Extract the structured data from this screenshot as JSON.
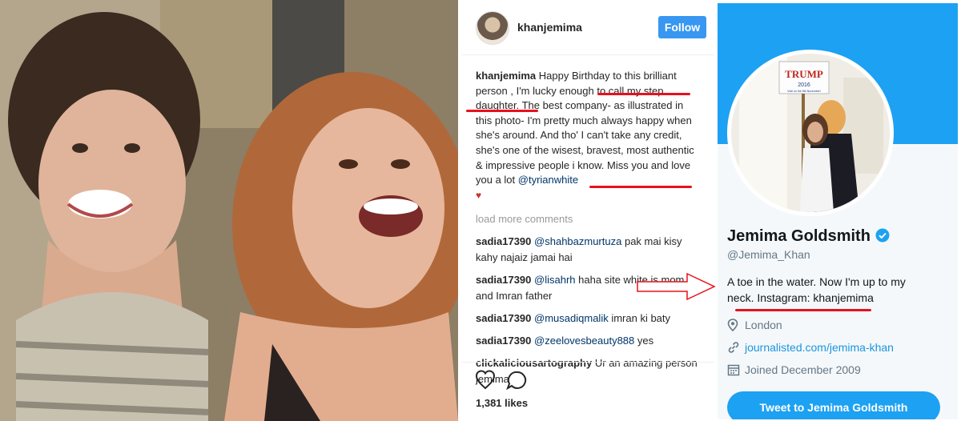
{
  "instagram": {
    "username": "khanjemima",
    "follow_label": "Follow",
    "caption_user": "khanjemima",
    "caption_text": "Happy Birthday to this brilliant person , I'm lucky enough to call my step daughter. The best company- as illustrated in this photo- I'm pretty much always happy when she's around. And tho' I can't take any credit, she's one of the wisest, bravest, most authentic & impressive people i know. Miss you and love you a lot",
    "caption_mention": "@tyrianwhite",
    "heart": "♥",
    "load_more": "load more comments",
    "comments": [
      {
        "user": "sadia17390",
        "mention": "@shahbazmurtuza",
        "text": "pak mai kisy kahy najaiz jamai hai"
      },
      {
        "user": "sadia17390",
        "mention": "@lisahrh",
        "text": "haha site white is mom and Imran father"
      },
      {
        "user": "sadia17390",
        "mention": "@musadiqmalik",
        "text": "imran ki baty"
      },
      {
        "user": "sadia17390",
        "mention": "@zeelovesbeauty888",
        "text": "yes"
      },
      {
        "user": "clickaliciousartography",
        "mention": "",
        "text": "Ur an amazing person jemima"
      }
    ],
    "likes": "1,381 likes",
    "icons": [
      "heart-icon",
      "comment-icon"
    ]
  },
  "twitter": {
    "name": "Jemima Goldsmith",
    "handle": "@Jemima_Khan",
    "bio": "A toe in the water. Now I'm up to my neck. Instagram: khanjemima",
    "location": "London",
    "website": "journalisted.com/jemima-khan",
    "joined": "Joined December 2009",
    "tweet_button": "Tweet to Jemima Goldsmith",
    "sign_text": "TRUMP",
    "sign_year": "2016",
    "sign_sub": "Vote on the 8th November!",
    "icons": [
      "verified-icon",
      "location-pin-icon",
      "link-icon",
      "calendar-icon"
    ],
    "accent_color": "#1da1f2"
  }
}
